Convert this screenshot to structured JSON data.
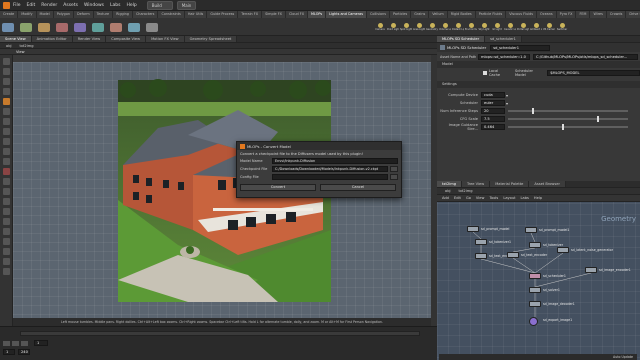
{
  "menubar": {
    "items": [
      "File",
      "Edit",
      "Render",
      "Assets",
      "Windows",
      "Labs",
      "Help"
    ],
    "desktop": "Build",
    "context": "Main"
  },
  "shelf": {
    "tabs": [
      "Create",
      "Modify",
      "Model",
      "Polygon",
      "Deform",
      "Texture",
      "Rigging",
      "Characters",
      "Constraints",
      "Hair Utils",
      "Guide Process",
      "Terrain FX",
      "Simple FX",
      "Cloud FX",
      "MLOPs"
    ],
    "light_tabs": [
      "Lights and Cameras",
      "Collisions",
      "Particles",
      "Grains",
      "Vellum",
      "Rigid Bodies",
      "Particle Fluids",
      "Viscous Fluids",
      "Oceans",
      "Pyro FX",
      "FEM",
      "Wires",
      "Crowds",
      "Drive Simulation"
    ],
    "light_tools": [
      "Camera",
      "Point Light",
      "Spot Light",
      "Area Light",
      "Geometry Light",
      "Volume Light",
      "Distant Light",
      "Environment Light",
      "Sky Light",
      "GI Light",
      "Caustic Light",
      "Portal Light",
      "Ambient Light",
      "VR Camera",
      "Switcher"
    ]
  },
  "left_pane": {
    "tabs": [
      "Scene View",
      "Animation Editor",
      "Render View",
      "Composite View",
      "Motion FX View",
      "Geometry Spreadsheet"
    ],
    "path": "obj",
    "node": "txt2img",
    "view_label": "View",
    "status_text": "Left mouse tumbles. Middle pans. Right dollies. Ctrl+Alt+Left box zooms. Ctrl+Right zooms. Spacebar Ctrl+Left tilts. Hold L for alternate tumble, dolly, and zoom.    M or Alt+M for First Person Navigation."
  },
  "dialog": {
    "title": "MLOPs - Convert Model",
    "description": "Convert a checkpoint file to the Diffusers model used by this plugin!",
    "model_name_label": "Model Name",
    "model_name_value": "Envvi/Inkpunk-Diffusion",
    "checkpoint_label": "Checkpoint File",
    "checkpoint_value": "C:/Downloads/Downloaded/Models/Inkpunk-Diffusion-v2.ckpt",
    "config_label": "Config File",
    "config_value": "",
    "convert_button": "Convert",
    "cancel_button": "Cancel"
  },
  "right_pane": {
    "tabs": [
      "MLOPs SD Scheduler",
      "sd_scheduler1"
    ],
    "node_header": "MLOPs SD Scheduler",
    "node_name": "sd_scheduler1",
    "asset_label": "Asset Name and Path",
    "asset_value": "mlops::sd_scheduler::1.0",
    "asset_path": "C:/Github/MLOPs/MLOPs/otls/mlops_sd_scheduler...",
    "model_section": "Model",
    "local_cache_label": "Local Cache",
    "scheduler_model_label": "Scheduler Model",
    "scheduler_model_value": "$MLOPS_MODEL",
    "settings_section": "Settings",
    "params": [
      {
        "label": "Compute Device",
        "value": "cuda",
        "fill": null
      },
      {
        "label": "Scheduler",
        "value": "euler",
        "fill": null
      },
      {
        "label": "Num Inference Steps",
        "value": "20",
        "fill": 0.2
      },
      {
        "label": "CFG Scale",
        "value": "7.5",
        "fill": 0.75
      },
      {
        "label": "Image Guidance Stre...",
        "value": "0.464",
        "fill": 0.46
      }
    ]
  },
  "network": {
    "tabs": [
      "txt2img",
      "Tree View",
      "Material Palette",
      "Asset Browser"
    ],
    "path": "obj",
    "node": "txt2img",
    "menu": [
      "Add",
      "Edit",
      "Go",
      "View",
      "Tools",
      "Layout",
      "Labs",
      "Help"
    ],
    "context_label": "Geometry",
    "nodes": [
      "sd_prompt_model",
      "sd_prompt_model1",
      "sd_tokenizer1",
      "sd_tokenizer",
      "sd_text_encoder1",
      "sd_text_encoder",
      "sd_latent_noise_generator",
      "sd_scheduler1",
      "sd_image_encoder1",
      "sd_solver1",
      "sd_image_decoder1",
      "sd_export_image1"
    ]
  },
  "timeline": {
    "frame": "1",
    "start": "1",
    "end": "240",
    "auto_update": "Auto Update",
    "path": "/obj/txt2img/sd_export"
  }
}
